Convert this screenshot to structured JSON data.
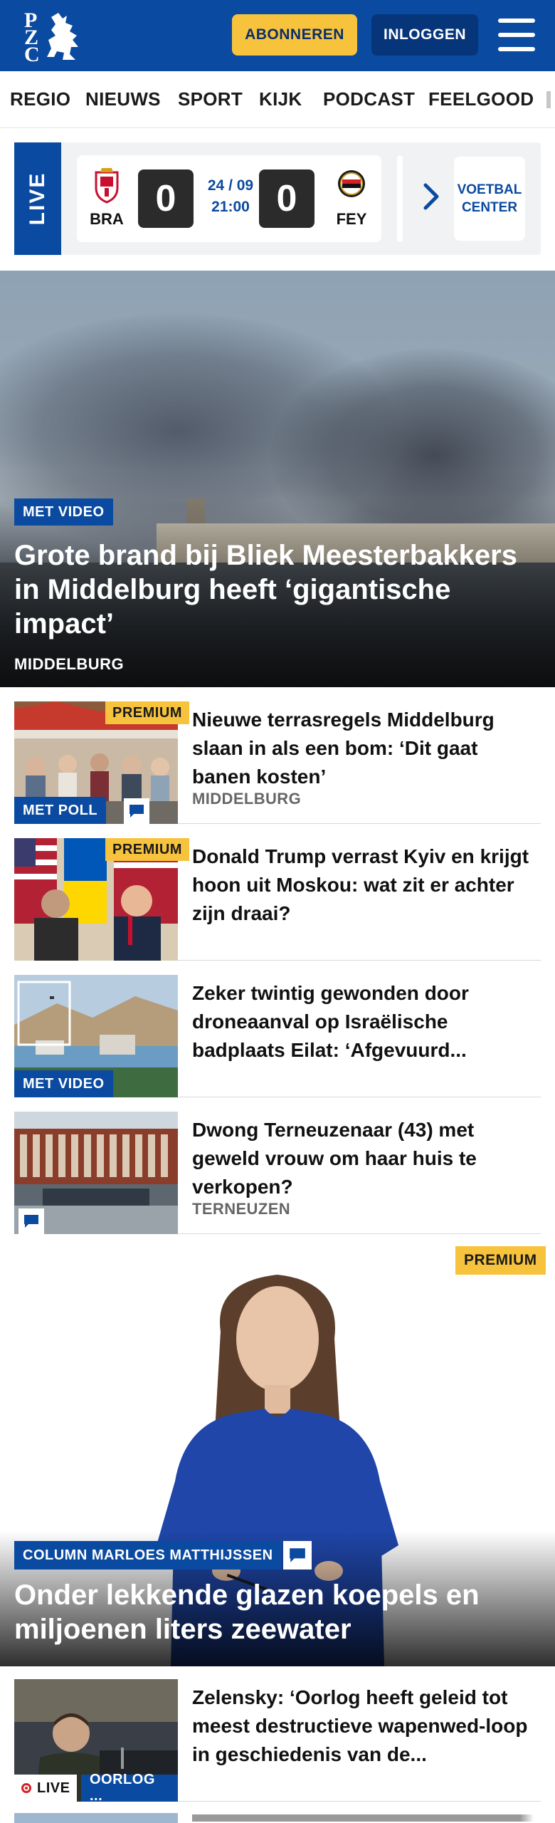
{
  "header": {
    "logo_letters": [
      "P",
      "Z",
      "C"
    ],
    "subscribe_label": "ABONNEREN",
    "login_label": "INLOGGEN",
    "menu_icon": "hamburger-menu-icon"
  },
  "nav": {
    "items": [
      "REGIO",
      "NIEUWS",
      "SPORT",
      "KIJK",
      "PODCAST",
      "FEELGOOD"
    ]
  },
  "live_widget": {
    "tag": "LIVE",
    "home_team": "BRA",
    "away_team": "FEY",
    "home_score": "0",
    "away_score": "0",
    "date": "24 / 09",
    "time": "21:00",
    "voetbal_center": [
      "VOETBAL",
      "CENTER"
    ]
  },
  "hero": {
    "badge": "MET VIDEO",
    "title": "Grote brand bij Bliek Meesterbakkers in Middelburg heeft ‘gigantische impact’",
    "location": "MIDDELBURG"
  },
  "articles": [
    {
      "title": "Nieuwe terrasregels Middelburg slaan in als een bom: ‘Dit gaat banen kosten’",
      "location": "MIDDELBURG",
      "premium": "PREMIUM",
      "badge": "MET POLL"
    },
    {
      "title": "Donald Trump verrast Kyiv en krijgt hoon uit Moskou: wat zit er achter zijn draai?",
      "premium": "PREMIUM"
    },
    {
      "title": "Zeker twintig gewonden door droneaanval op Israëlische badplaats Eilat: ‘Afgevuurd...",
      "badge": "MET VIDEO"
    },
    {
      "title": "Dwong Terneuzenaar (43) met geweld vrouw om haar huis te verkopen?",
      "location": "TERNEUZEN"
    }
  ],
  "column": {
    "premium": "PREMIUM",
    "badge": "COLUMN MARLOES MATTHIJSSEN",
    "title": "Onder lekkende glazen koepels en miljoenen liters zeewater"
  },
  "bottom_article": {
    "title": "Zelensky: ‘Oorlog heeft geleid tot meest destructieve wapenwed-loop in geschiedenis van de...",
    "live_label": "LIVE",
    "tag": "OORLOG ..."
  },
  "colors": {
    "brand_blue": "#0a4aa0",
    "premium_yellow": "#f7c23c",
    "live_red": "#d81f26"
  }
}
